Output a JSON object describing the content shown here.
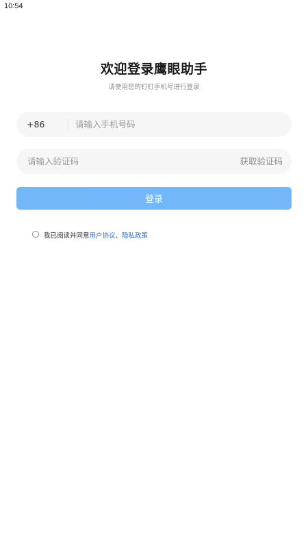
{
  "status_bar": {
    "time": "10:54"
  },
  "header": {
    "title": "欢迎登录鹰眼助手",
    "subtitle": "请使用您的钉钉手机号进行登录"
  },
  "phone_field": {
    "country_code": "+86",
    "value": "",
    "placeholder": "请输入手机号码"
  },
  "code_field": {
    "value": "",
    "placeholder": "请输入验证码",
    "get_code_label": "获取验证码"
  },
  "login": {
    "label": "登录",
    "color": "#6ab4f9",
    "enabled": false
  },
  "agreement": {
    "checked": false,
    "prefix": "我已阅读并同意",
    "user_agreement": "用户协议",
    "separator": "、",
    "privacy_policy": "隐私政策",
    "link_color": "#2a6fd6"
  }
}
